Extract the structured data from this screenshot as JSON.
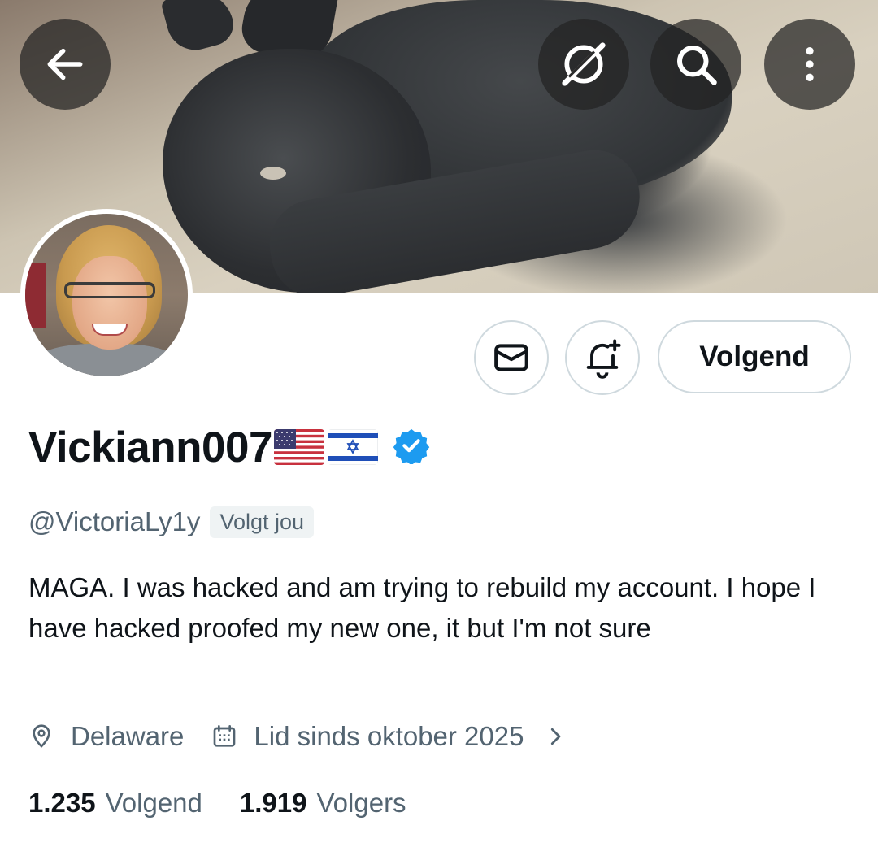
{
  "header": {
    "back_icon": "arrow-left-icon",
    "grok_icon": "grok-icon",
    "search_icon": "search-icon",
    "more_icon": "more-vertical-icon"
  },
  "profile": {
    "display_name": "Vickiann007",
    "flags": [
      "🇺🇸",
      "🇮🇱"
    ],
    "verified": true,
    "handle": "@VictoriaLy1y",
    "follows_you_label": "Volgt jou",
    "bio": "MAGA. I was hacked and am trying to rebuild my account. I hope I have hacked proofed my new one, it but I'm not sure",
    "location": "Delaware",
    "joined": "Lid sinds oktober 2025",
    "following_count": "1.235",
    "following_label": "Volgend",
    "followers_count": "1.919",
    "followers_label": "Volgers"
  },
  "actions": {
    "message_icon": "mail-icon",
    "notify_icon": "bell-plus-icon",
    "follow_label": "Volgend"
  },
  "colors": {
    "text_primary": "#0f1419",
    "text_secondary": "#536471",
    "border": "#cfd9de",
    "verified_blue": "#1d9bf0",
    "badge_bg": "#eff3f4"
  }
}
